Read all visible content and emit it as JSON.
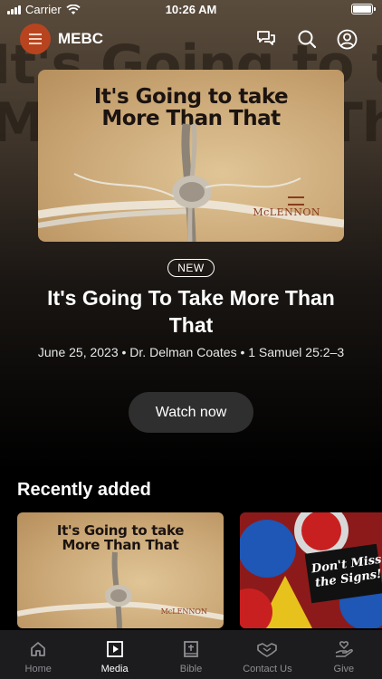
{
  "status_bar": {
    "carrier": "Carrier",
    "time": "10:26 AM"
  },
  "header": {
    "app_name": "MEBC"
  },
  "featured": {
    "artwork_title_line1": "It's Going to take",
    "artwork_title_line2": "More Than That",
    "artwork_brand": "McLENNON",
    "badge": "NEW",
    "title": "It's Going To Take More Than That",
    "meta": "June 25, 2023 • Dr. Delman Coates • 1 Samuel 25:2–3",
    "watch_label": "Watch now"
  },
  "recent": {
    "heading": "Recently added",
    "items": [
      {
        "line1": "It's Going to take",
        "line2": "More Than That",
        "brand": "McLENNON"
      },
      {
        "line1": "Don't Miss",
        "line2": "the Signs!"
      }
    ]
  },
  "tabs": [
    {
      "label": "Home",
      "icon": "home-icon",
      "active": false
    },
    {
      "label": "Media",
      "icon": "play-icon",
      "active": true
    },
    {
      "label": "Bible",
      "icon": "bible-icon",
      "active": false
    },
    {
      "label": "Contact Us",
      "icon": "handshake-icon",
      "active": false
    },
    {
      "label": "Give",
      "icon": "give-icon",
      "active": false
    }
  ],
  "colors": {
    "accent": "#b8441f",
    "tab_bar": "#1c1c1e",
    "button": "#2f2f2f"
  }
}
